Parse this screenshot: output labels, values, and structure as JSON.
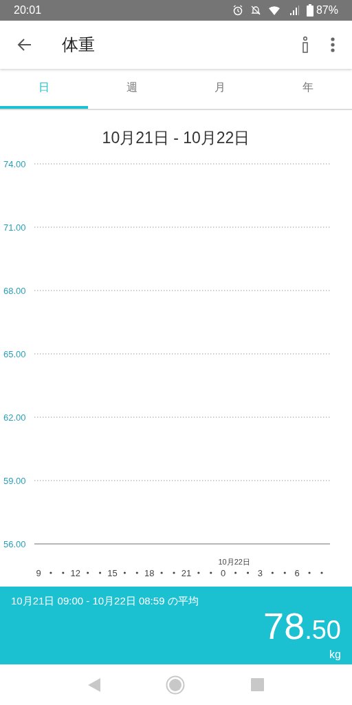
{
  "status_bar": {
    "time": "20:01",
    "battery": "87%"
  },
  "app_bar": {
    "title": "体重"
  },
  "tabs": [
    {
      "label": "日",
      "selected": true
    },
    {
      "label": "週",
      "selected": false
    },
    {
      "label": "月",
      "selected": false
    },
    {
      "label": "年",
      "selected": false
    }
  ],
  "range_title": "10月21日 - 10月22日",
  "chart_data": {
    "type": "line",
    "ylim": [
      56,
      74
    ],
    "yticks": [
      {
        "value": 74,
        "label": "74.00"
      },
      {
        "value": 71,
        "label": "71.00"
      },
      {
        "value": 68,
        "label": "68.00"
      },
      {
        "value": 65,
        "label": "65.00"
      },
      {
        "value": 62,
        "label": "62.00"
      },
      {
        "value": 59,
        "label": "59.00"
      },
      {
        "value": 56,
        "label": "56.00"
      }
    ],
    "categories": [
      "9",
      "12",
      "15",
      "18",
      "21",
      "0",
      "3",
      "6"
    ],
    "grid": true,
    "annotations": [
      "10月22日"
    ]
  },
  "summary": {
    "period": "10月21日 09:00 - 10月22日 08:59 の平均",
    "value_int": "78",
    "value_dec": ".50",
    "unit": "kg"
  }
}
